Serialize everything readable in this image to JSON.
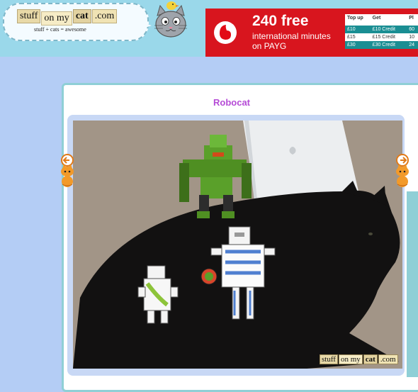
{
  "header": {
    "logo_words": [
      "stuff",
      "on my",
      "cat",
      ".com"
    ],
    "tagline": "stuff + cats = awesome",
    "mascot_icon": "cat-with-bird-icon"
  },
  "ad": {
    "headline": "240 free",
    "subline1": "international minutes",
    "subline2": "on PAYG",
    "brand_icon": "vodafone-logo-icon",
    "table": {
      "headers": [
        "Top up",
        "Get",
        "Pl"
      ],
      "header_cut": [
        "60",
        "10",
        "24"
      ],
      "rows": [
        [
          "£10",
          "£10 Credit",
          "60"
        ],
        [
          "£15",
          "£15 Credit",
          "10"
        ],
        [
          "£30",
          "£30 Credit",
          "24"
        ]
      ]
    },
    "color": "#d8151e"
  },
  "post": {
    "title": "Robocat",
    "watermark_words": [
      "stuff",
      "on my",
      "cat",
      ".com"
    ]
  },
  "nav": {
    "prev_icon": "orange-cat-left-arrow-icon",
    "next_icon": "orange-cat-right-arrow-icon"
  },
  "colors": {
    "page_bg": "#b4cdf5",
    "header_bg": "#9ad8ea",
    "title": "#b54bd6",
    "card_border": "#8fcfd6"
  }
}
